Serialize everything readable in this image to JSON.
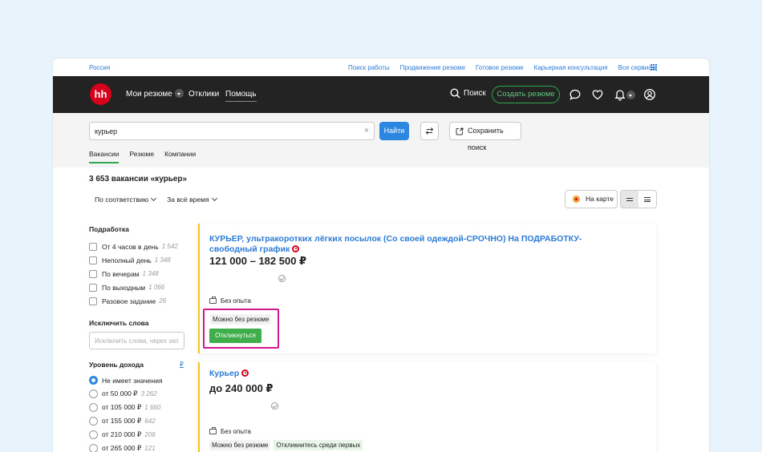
{
  "topbar": {
    "region": "Россия",
    "links": [
      "Поиск работы",
      "Продвижение резюме",
      "Готовое резюме",
      "Карьерная консультация",
      "Все сервисы"
    ]
  },
  "nav": {
    "logo": "hh",
    "my_resumes": "Мои резюме",
    "responses": "Отклики",
    "help": "Помощь",
    "search": "Поиск",
    "create_resume": "Создать резюме",
    "icons": [
      "chat-icon",
      "heart-icon",
      "bell-icon",
      "profile-icon"
    ]
  },
  "search": {
    "query": "курьер",
    "find_label": "Найти",
    "save_label": "Сохранить поиск",
    "tabs": [
      "Вакансии",
      "Резюме",
      "Компании"
    ]
  },
  "results": {
    "count": "3 653 вакансии «курьер»",
    "sort": "По соответствию",
    "period": "За всё время",
    "map_label": "На карте"
  },
  "sidebar": {
    "part_time_title": "Подработка",
    "part_time": [
      {
        "label": "От 4 часов в день",
        "count": "1 542"
      },
      {
        "label": "Неполный день",
        "count": "1 348"
      },
      {
        "label": "По вечерам",
        "count": "1 348"
      },
      {
        "label": "По выходным",
        "count": "1 066"
      },
      {
        "label": "Разовое задание",
        "count": "26"
      }
    ],
    "exclude_title": "Исключить слова",
    "exclude_placeholder": "Исключить слова, через зап",
    "income_title": "Уровень дохода",
    "income_info": "₽",
    "income": [
      {
        "label": "Не имеет значения",
        "count": "",
        "selected": true
      },
      {
        "label": "от 50 000 ₽",
        "count": "3 262",
        "selected": false
      },
      {
        "label": "от 105 000 ₽",
        "count": "1 660",
        "selected": false
      },
      {
        "label": "от 155 000 ₽",
        "count": "642",
        "selected": false
      },
      {
        "label": "от 210 000 ₽",
        "count": "206",
        "selected": false
      },
      {
        "label": "от 265 000 ₽",
        "count": "121",
        "selected": false
      }
    ]
  },
  "vacancies": [
    {
      "title": "КУРЬЕР, ультракоротких лёгких посылок (Со своей одеждой-СРОЧНО) На ПОДРАБОТКУ-свободный график",
      "salary": "121 000 – 182 500 ₽",
      "experience": "Без опыта",
      "no_resume": "Можно без резюме",
      "apply": "Откликнуться"
    },
    {
      "title": "Курьер",
      "salary": "до 240 000 ₽",
      "experience": "Без опыта",
      "no_resume": "Можно без резюме",
      "early": "Откликнитесь среди первых"
    }
  ]
}
